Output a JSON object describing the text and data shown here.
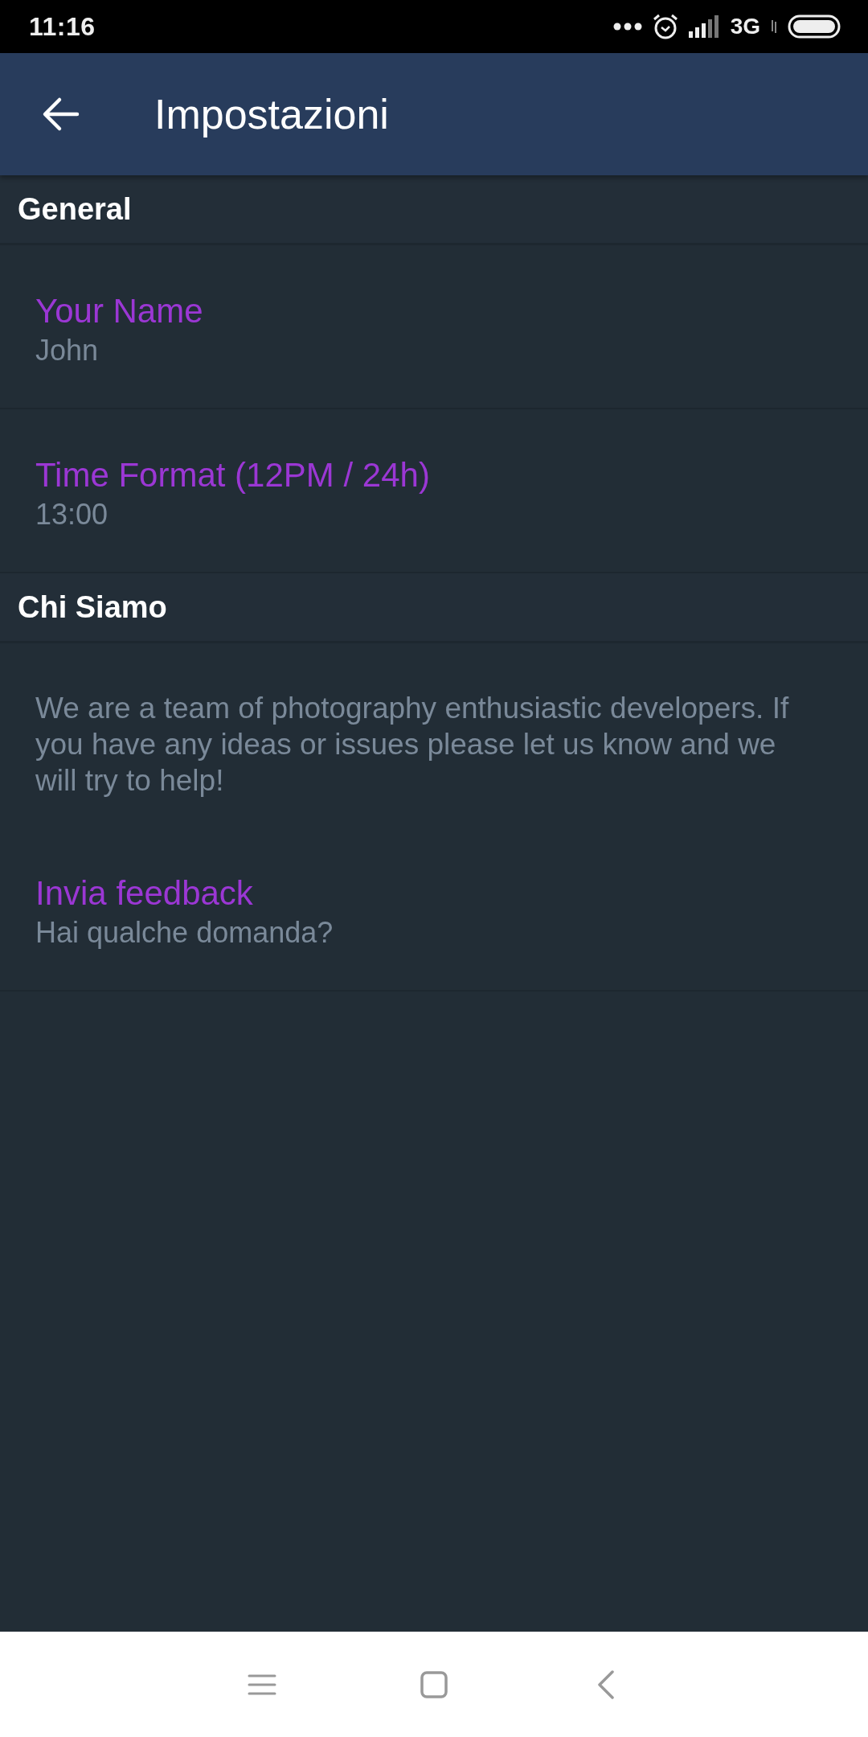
{
  "status_bar": {
    "time": "11:16",
    "network": "3G"
  },
  "app_bar": {
    "title": "Impostazioni"
  },
  "sections": [
    {
      "title": "General",
      "items": [
        {
          "kind": "preference",
          "title": "Your Name",
          "summary": "John"
        },
        {
          "kind": "preference",
          "title": "Time Format (12PM / 24h)",
          "summary": "13:00"
        }
      ]
    },
    {
      "title": "Chi Siamo",
      "items": [
        {
          "kind": "text",
          "text": "We are a team of photography enthusiastic developers. If you have any ideas or issues please let us know and we will try to help!"
        },
        {
          "kind": "preference",
          "title": "Invia feedback",
          "summary": "Hai qualche domanda?"
        }
      ]
    }
  ]
}
